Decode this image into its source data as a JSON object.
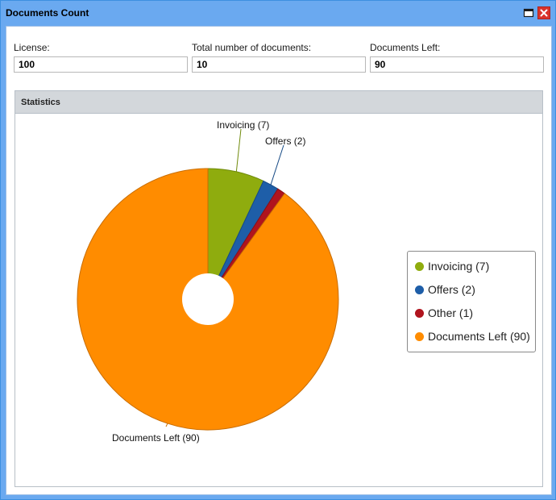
{
  "window": {
    "title": "Documents Count"
  },
  "fields": {
    "license": {
      "label": "License:",
      "value": "100"
    },
    "total": {
      "label": "Total number of documents:",
      "value": "10"
    },
    "left": {
      "label": "Documents Left:",
      "value": "90"
    }
  },
  "statistics": {
    "title": "Statistics"
  },
  "chart_data": {
    "type": "pie",
    "donut": true,
    "categories": [
      "Invoicing",
      "Offers",
      "Other",
      "Documents Left"
    ],
    "values": [
      7,
      2,
      1,
      90
    ],
    "data_labels": [
      "Invoicing (7)",
      "Offers (2)",
      "",
      "Documents Left (90)"
    ],
    "legend": {
      "placement": "right",
      "entries": [
        "Invoicing (7)",
        "Offers (2)",
        "Other (1)",
        "Documents Left (90)"
      ]
    },
    "colors": [
      "#8fac0e",
      "#1e5ea8",
      "#b0141e",
      "#ff8c00"
    ]
  }
}
